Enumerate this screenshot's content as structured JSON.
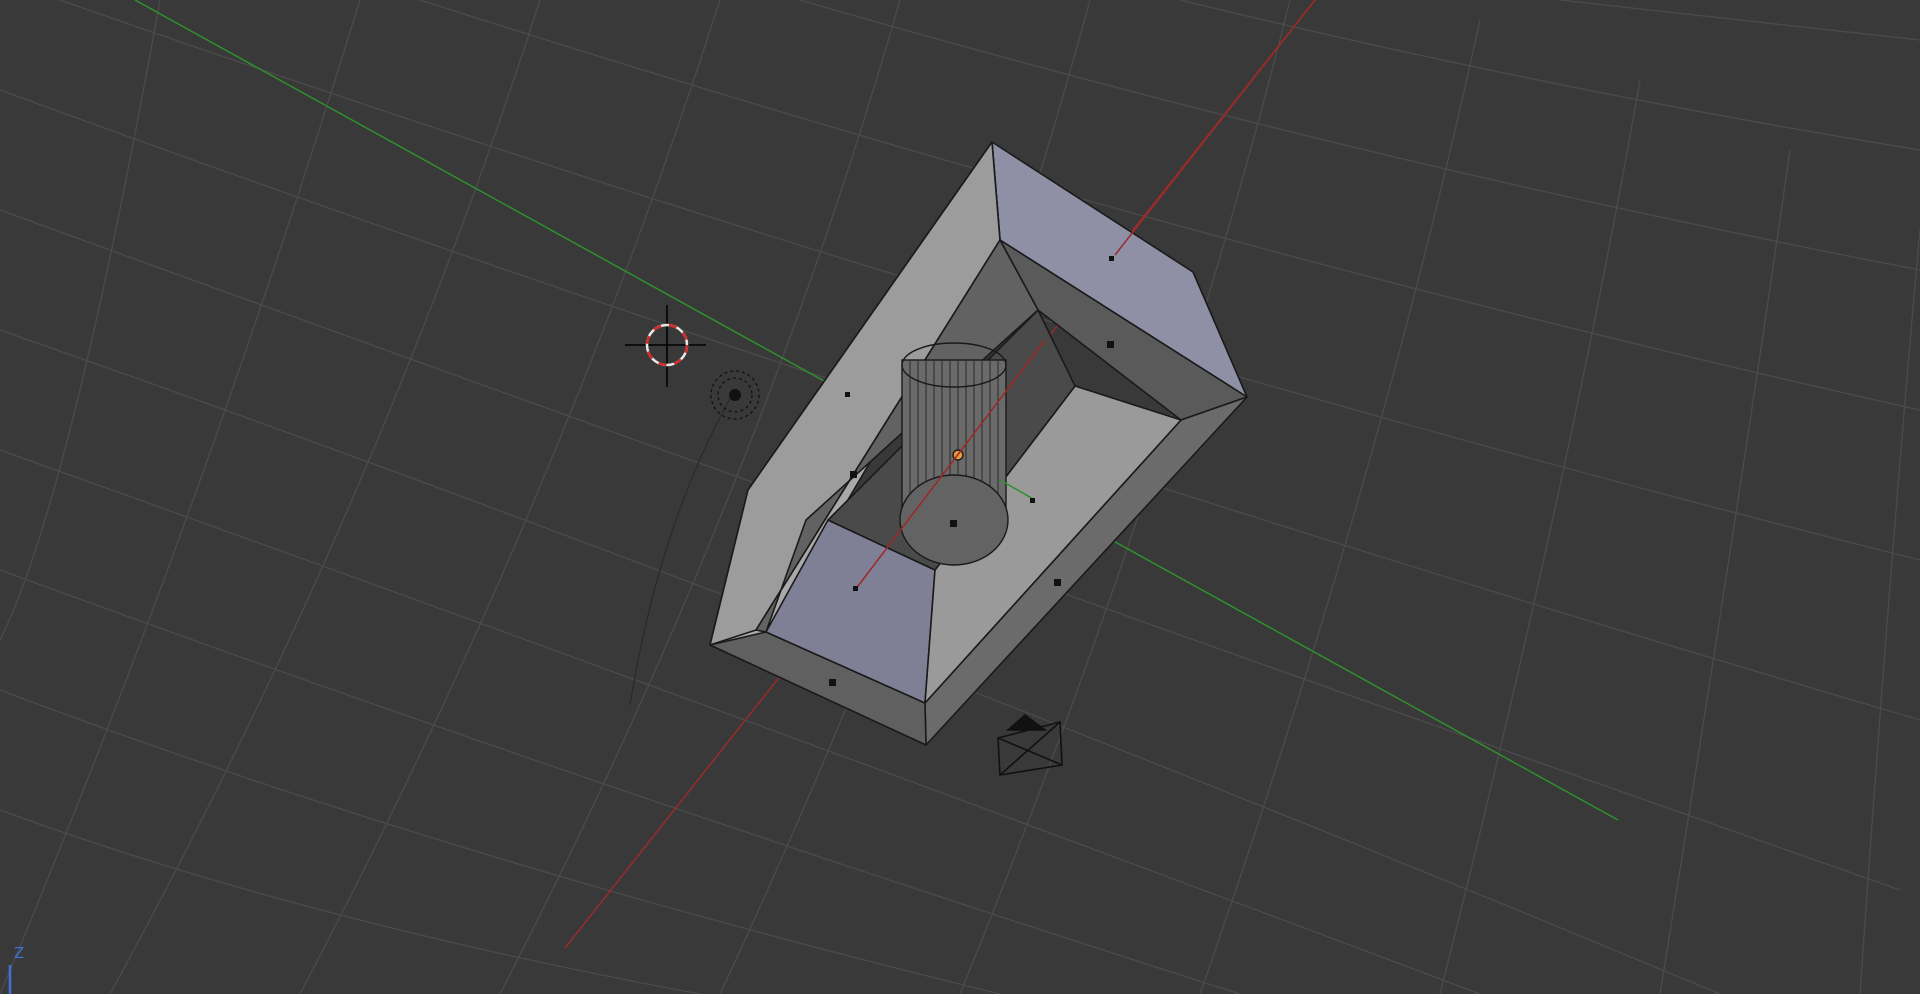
{
  "viewport": {
    "background": "#393939",
    "grid_color": "#4d4d4d",
    "axis_x_color": "#a02626",
    "axis_y_color": "#2f8f2f",
    "mini_axis_z_color": "#3b73d6",
    "mini_axis_label": "Z"
  },
  "objects": {
    "frame_mesh": "rectangular-frame-mesh",
    "cylinder_mesh": "cylinder-mesh",
    "lamp": "lamp-icon",
    "camera": "camera-icon",
    "cursor": "3d-cursor-icon"
  }
}
